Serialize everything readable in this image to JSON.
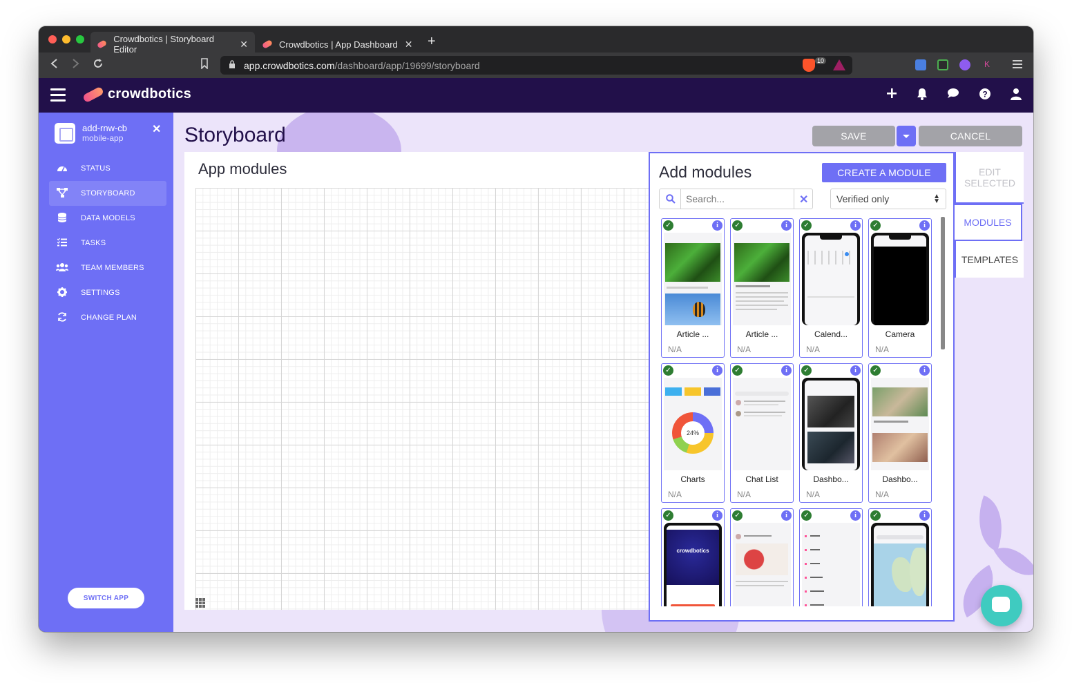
{
  "browser": {
    "tabs": [
      {
        "title": "Crowdbotics | Storyboard Editor",
        "close": "✕"
      },
      {
        "title": "Crowdbotics | App Dashboard",
        "close": "✕"
      }
    ],
    "new_tab": "+",
    "url_host": "app.crowdbotics.com",
    "url_path": "/dashboard/app/19699/storyboard",
    "brave_badge": "10"
  },
  "header": {
    "logo_text": "crowdbotics",
    "icons": [
      "plus-icon",
      "bell-icon",
      "chat-icon",
      "help-icon",
      "user-icon"
    ]
  },
  "sidebar": {
    "project_name": "add-rnw-cb",
    "project_type": "mobile-app",
    "items": [
      {
        "label": "STATUS",
        "icon": "gauge-icon"
      },
      {
        "label": "STORYBOARD",
        "icon": "storyboard-icon"
      },
      {
        "label": "DATA MODELS",
        "icon": "database-icon"
      },
      {
        "label": "TASKS",
        "icon": "tasks-icon"
      },
      {
        "label": "TEAM MEMBERS",
        "icon": "team-icon"
      },
      {
        "label": "SETTINGS",
        "icon": "gear-icon"
      },
      {
        "label": "CHANGE PLAN",
        "icon": "refresh-icon"
      }
    ],
    "switch_app": "SWITCH APP"
  },
  "main": {
    "title": "Storyboard",
    "save": "SAVE",
    "cancel": "CANCEL",
    "canvas_title": "App modules"
  },
  "add_modules": {
    "title": "Add modules",
    "create_button": "CREATE A MODULE",
    "search_placeholder": "Search...",
    "filter_value": "Verified only",
    "modules": [
      {
        "name": "Article ...",
        "value": "N/A"
      },
      {
        "name": "Article ...",
        "value": "N/A"
      },
      {
        "name": "Calend...",
        "value": "N/A"
      },
      {
        "name": "Camera",
        "value": "N/A"
      },
      {
        "name": "Charts",
        "value": "N/A"
      },
      {
        "name": "Chat List",
        "value": "N/A"
      },
      {
        "name": "Dashbo...",
        "value": "N/A"
      },
      {
        "name": "Dashbo...",
        "value": "N/A"
      },
      {
        "name": "",
        "value": ""
      },
      {
        "name": "",
        "value": ""
      },
      {
        "name": "",
        "value": ""
      },
      {
        "name": "",
        "value": ""
      }
    ]
  },
  "right_tabs": {
    "edit_selected": "EDIT SELECTED",
    "modules": "MODULES",
    "templates": "TEMPLATES"
  },
  "colors": {
    "brand": "#6e6ff5",
    "header": "#22104a",
    "verified": "#2e7d32"
  }
}
